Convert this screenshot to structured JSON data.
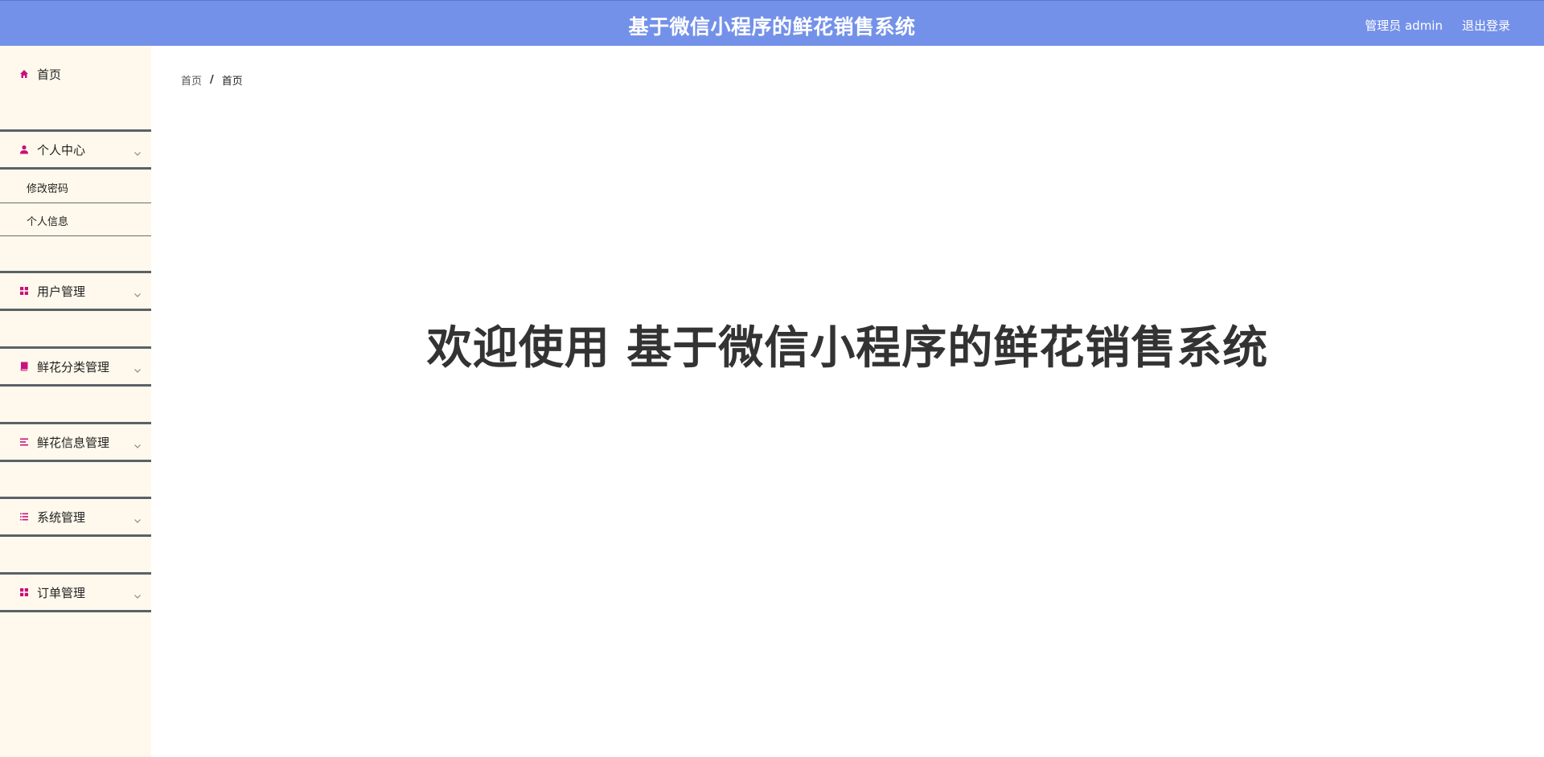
{
  "header": {
    "title": "基于微信小程序的鲜花销售系统",
    "user_label": "管理员 admin",
    "logout_label": "退出登录"
  },
  "sidebar": {
    "home": {
      "label": "首页",
      "icon": "home-icon"
    },
    "personal_center": {
      "label": "个人中心",
      "icon": "user-icon",
      "children": [
        {
          "label": "修改密码"
        },
        {
          "label": "个人信息"
        }
      ]
    },
    "user_management": {
      "label": "用户管理",
      "icon": "grid-icon"
    },
    "flower_category_management": {
      "label": "鲜花分类管理",
      "icon": "book-icon"
    },
    "flower_info_management": {
      "label": "鲜花信息管理",
      "icon": "list-icon"
    },
    "system_management": {
      "label": "系统管理",
      "icon": "list-icon"
    },
    "order_management": {
      "label": "订单管理",
      "icon": "grid-icon"
    }
  },
  "breadcrumb": {
    "items": [
      "首页",
      "首页"
    ],
    "separator": "/"
  },
  "main": {
    "welcome_text": "欢迎使用 基于微信小程序的鲜花销售系统"
  },
  "colors": {
    "header_bg": "#7491e9",
    "sidebar_bg": "#fef9ec",
    "icon_accent": "#c8127c",
    "menu_border": "#5b6168"
  }
}
